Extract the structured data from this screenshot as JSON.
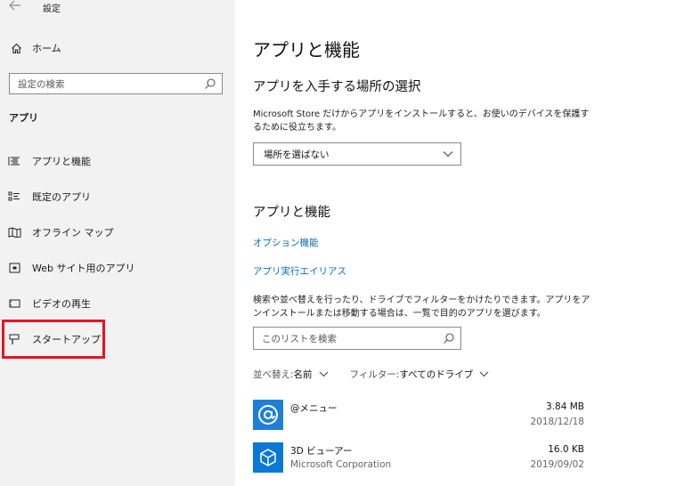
{
  "window": {
    "title": "設定"
  },
  "sidebar": {
    "home_label": "ホーム",
    "search_placeholder": "設定の検索",
    "section_label": "アプリ",
    "items": [
      {
        "label": "アプリと機能",
        "icon": "list-icon"
      },
      {
        "label": "既定のアプリ",
        "icon": "default-apps-icon"
      },
      {
        "label": "オフライン マップ",
        "icon": "map-icon"
      },
      {
        "label": "Web サイト用のアプリ",
        "icon": "web-app-icon"
      },
      {
        "label": "ビデオの再生",
        "icon": "video-icon"
      },
      {
        "label": "スタートアップ",
        "icon": "startup-icon"
      }
    ],
    "highlight_color": "#e8131f"
  },
  "main": {
    "title": "アプリと機能",
    "install_section": {
      "heading": "アプリを入手する場所の選択",
      "description": "Microsoft Store だけからアプリをインストールすると、お使いのデバイスを保護するために役立ちます。",
      "select_value": "場所を選ばない"
    },
    "apps_section": {
      "heading": "アプリと機能",
      "links": [
        "オプション機能",
        "アプリ実行エイリアス"
      ],
      "description": "検索や並べ替えを行ったり、ドライブでフィルターをかけたりできます。アプリをアンインストールまたは移動する場合は、一覧で目的のアプリを選びます。",
      "search_placeholder": "このリストを検索",
      "sort": {
        "label": "並べ替え:",
        "value": "名前"
      },
      "filter": {
        "label": "フィルター:",
        "value": "すべてのドライブ"
      },
      "apps": [
        {
          "name": "@メニュー",
          "publisher": "",
          "size": "3.84 MB",
          "date": "2018/12/18",
          "tile_color": "#1f7fd8",
          "icon": "at-sign-icon"
        },
        {
          "name": "3D ビューアー",
          "publisher": "Microsoft Corporation",
          "size": "16.0 KB",
          "date": "2019/09/02",
          "tile_color": "#0a78d7",
          "icon": "cube-icon"
        }
      ]
    },
    "link_color": "#0a6cb5"
  }
}
